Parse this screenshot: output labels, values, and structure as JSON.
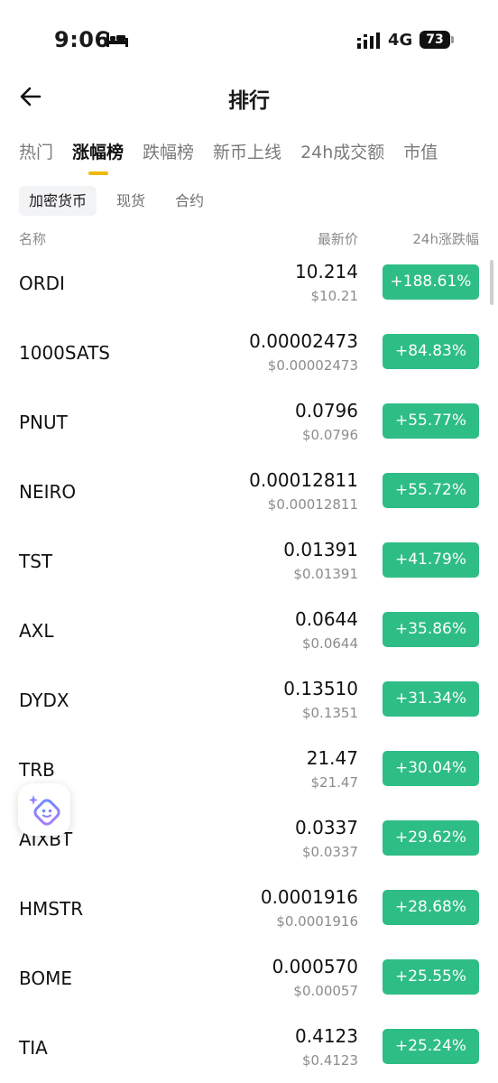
{
  "status_bar": {
    "time": "9:06",
    "network": "4G",
    "battery": "73"
  },
  "header": {
    "title": "排行"
  },
  "tabs": [
    {
      "label": "热门",
      "active": false
    },
    {
      "label": "涨幅榜",
      "active": true
    },
    {
      "label": "跌幅榜",
      "active": false
    },
    {
      "label": "新币上线",
      "active": false
    },
    {
      "label": "24h成交额",
      "active": false
    },
    {
      "label": "市值",
      "active": false
    }
  ],
  "segments": [
    {
      "label": "加密货币",
      "active": true
    },
    {
      "label": "现货",
      "active": false
    },
    {
      "label": "合约",
      "active": false
    }
  ],
  "columns": {
    "name": "名称",
    "price": "最新价",
    "change": "24h涨跌幅"
  },
  "rows": [
    {
      "symbol": "ORDI",
      "price": "10.214",
      "usd": "$10.21",
      "change": "+188.61%"
    },
    {
      "symbol": "1000SATS",
      "price": "0.00002473",
      "usd": "$0.00002473",
      "change": "+84.83%"
    },
    {
      "symbol": "PNUT",
      "price": "0.0796",
      "usd": "$0.0796",
      "change": "+55.77%"
    },
    {
      "symbol": "NEIRO",
      "price": "0.00012811",
      "usd": "$0.00012811",
      "change": "+55.72%"
    },
    {
      "symbol": "TST",
      "price": "0.01391",
      "usd": "$0.01391",
      "change": "+41.79%"
    },
    {
      "symbol": "AXL",
      "price": "0.0644",
      "usd": "$0.0644",
      "change": "+35.86%"
    },
    {
      "symbol": "DYDX",
      "price": "0.13510",
      "usd": "$0.1351",
      "change": "+31.34%"
    },
    {
      "symbol": "TRB",
      "price": "21.47",
      "usd": "$21.47",
      "change": "+30.04%"
    },
    {
      "symbol": "AIXBT",
      "price": "0.0337",
      "usd": "$0.0337",
      "change": "+29.62%"
    },
    {
      "symbol": "HMSTR",
      "price": "0.0001916",
      "usd": "$0.0001916",
      "change": "+28.68%"
    },
    {
      "symbol": "BOME",
      "price": "0.000570",
      "usd": "$0.00057",
      "change": "+25.55%"
    },
    {
      "symbol": "TIA",
      "price": "0.4123",
      "usd": "$0.4123",
      "change": "+25.24%"
    }
  ],
  "colors": {
    "accent": "#f0b90b",
    "up": "#2ebd85"
  },
  "icons": {
    "back": "arrow-left-icon",
    "bed": "bed-icon",
    "signal": "signal-icon",
    "assistant": "ai-assistant-icon"
  }
}
